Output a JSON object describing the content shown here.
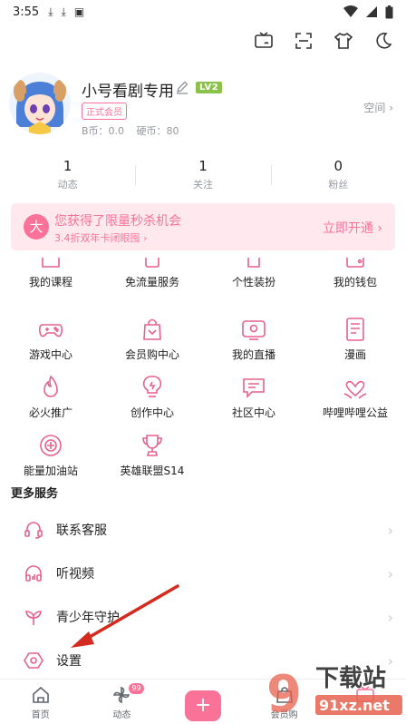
{
  "status": {
    "time": "3:55"
  },
  "profile": {
    "username": "小号看剧专用",
    "level": "LV2",
    "vip_label": "正式会员",
    "bcoin": "B币：0.0",
    "coin": "硬币：80",
    "space_link": "空间"
  },
  "stats": [
    {
      "num": "1",
      "label": "动态"
    },
    {
      "num": "1",
      "label": "关注"
    },
    {
      "num": "0",
      "label": "粉丝"
    }
  ],
  "promo": {
    "badge": "大",
    "title": "您获得了限量秒杀机会",
    "subtitle": "3.4折双年卡闭眼囤",
    "cta": "立即开通"
  },
  "grid": [
    [
      "我的课程",
      "免流量服务",
      "个性装扮",
      "我的钱包"
    ],
    [
      "游戏中心",
      "会员购中心",
      "我的直播",
      "漫画"
    ],
    [
      "必火推广",
      "创作中心",
      "社区中心",
      "哔哩哔哩公益"
    ],
    [
      "能量加油站",
      "英雄联盟S14"
    ]
  ],
  "more_services": {
    "title": "更多服务",
    "items": [
      "联系客服",
      "听视频",
      "青少年守护",
      "设置"
    ]
  },
  "nav": {
    "home": "首页",
    "dynamic": "动态",
    "badge": "99",
    "plus": "+",
    "mall": "会员购"
  },
  "watermark": {
    "text1": "下载站",
    "text2": "91xz.net",
    "logo": "9"
  },
  "colors": {
    "accent": "#fb7299",
    "promo_bg": "#ffe9ee",
    "level": "#8bc34a"
  }
}
